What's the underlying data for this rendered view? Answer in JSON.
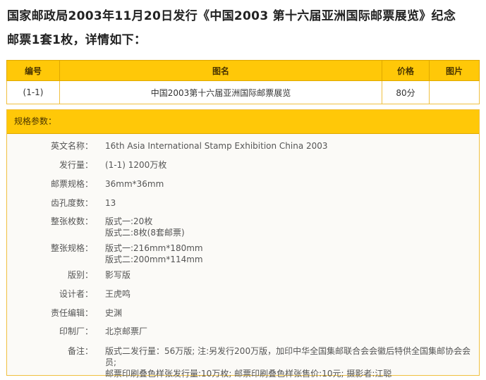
{
  "headline": {
    "line1": "国家邮政局2003年11月20日发行《中国2003  第十六届亚洲国际邮票展览》纪念",
    "line2": "邮票1套1枚，详情如下："
  },
  "table": {
    "headers": [
      "编号",
      "图名",
      "价格",
      "图片"
    ],
    "rows": [
      {
        "number": "(1-1)",
        "name": "中国2003第十六届亚洲国际邮票展览",
        "price": "80分",
        "image": ""
      }
    ]
  },
  "spec": {
    "title": "规格参数：",
    "fields": [
      {
        "label": "英文名称：",
        "value": "16th Asia International Stamp Exhibition China 2003"
      },
      {
        "label": "发行量：",
        "value": "(1-1) 1200万枚"
      },
      {
        "label": "邮票规格：",
        "value": "36mm*36mm"
      },
      {
        "label": "齿孔度数：",
        "value": "13"
      },
      {
        "label": "整张枚数：",
        "value": "版式一:20枚",
        "value2": "版式二:8枚(8套邮票)"
      },
      {
        "label": "整张规格：",
        "value": "版式一:216mm*180mm",
        "value2": "版式二:200mm*114mm"
      },
      {
        "label": "版别：",
        "value": "影写版"
      },
      {
        "label": "设计者：",
        "value": "王虎鸣"
      },
      {
        "label": "责任编辑：",
        "value": "史渊"
      },
      {
        "label": "印制厂：",
        "value": "北京邮票厂"
      },
      {
        "label": "备注：",
        "value": "版式二发行量：56万版; 注:另发行200万版，加印中华全国集邮联合会会徽后特供全国集邮协会会员;",
        "value2": "邮票印刷叠色样张发行量:10万枚; 邮票印刷叠色样张售价:10元; 摄影者:江聪"
      }
    ]
  }
}
